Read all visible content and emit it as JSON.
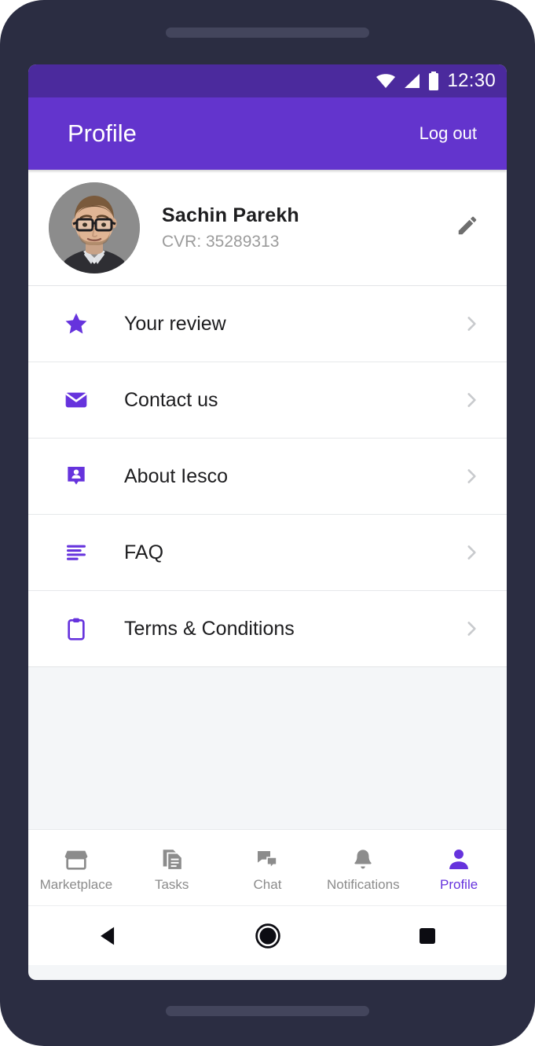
{
  "theme": {
    "status_bar_color": "#4b2a9d",
    "app_bar_color": "#6334cd",
    "accent_color": "#6633dd",
    "frame_color": "#2b2d42",
    "page_background": "#f4f6f8",
    "card_background": "#ffffff",
    "muted_text_color": "#9b9b9b"
  },
  "status_bar": {
    "time": "12:30",
    "icons": [
      "wifi-icon",
      "signal-icon",
      "battery-icon"
    ]
  },
  "app_bar": {
    "title": "Profile",
    "logout_label": "Log out"
  },
  "profile": {
    "avatar_name": "user-avatar-photo",
    "name": "Sachin Parekh",
    "cvr": "CVR: 35289313",
    "edit_icon": "pencil-icon"
  },
  "menu": {
    "items": [
      {
        "label": "Your review",
        "icon": "star-icon",
        "chevron": "chevron-right-icon"
      },
      {
        "label": "Contact us",
        "icon": "envelope-icon",
        "chevron": "chevron-right-icon"
      },
      {
        "label": "About Iesco",
        "icon": "contact-badge-icon",
        "chevron": "chevron-right-icon"
      },
      {
        "label": "FAQ",
        "icon": "list-lines-icon",
        "chevron": "chevron-right-icon"
      },
      {
        "label": "Terms & Conditions",
        "icon": "clipboard-icon",
        "chevron": "chevron-right-icon"
      }
    ]
  },
  "bottom_nav": {
    "items": [
      {
        "label": "Marketplace",
        "icon": "store-icon",
        "active": false
      },
      {
        "label": "Tasks",
        "icon": "documents-icon",
        "active": false
      },
      {
        "label": "Chat",
        "icon": "chat-bubbles-icon",
        "active": false
      },
      {
        "label": "Notifications",
        "icon": "bell-icon",
        "active": false
      },
      {
        "label": "Profile",
        "icon": "person-icon",
        "active": true
      }
    ]
  },
  "system_nav": {
    "back": "back-triangle-icon",
    "home": "home-circle-icon",
    "recents": "recents-square-icon"
  }
}
